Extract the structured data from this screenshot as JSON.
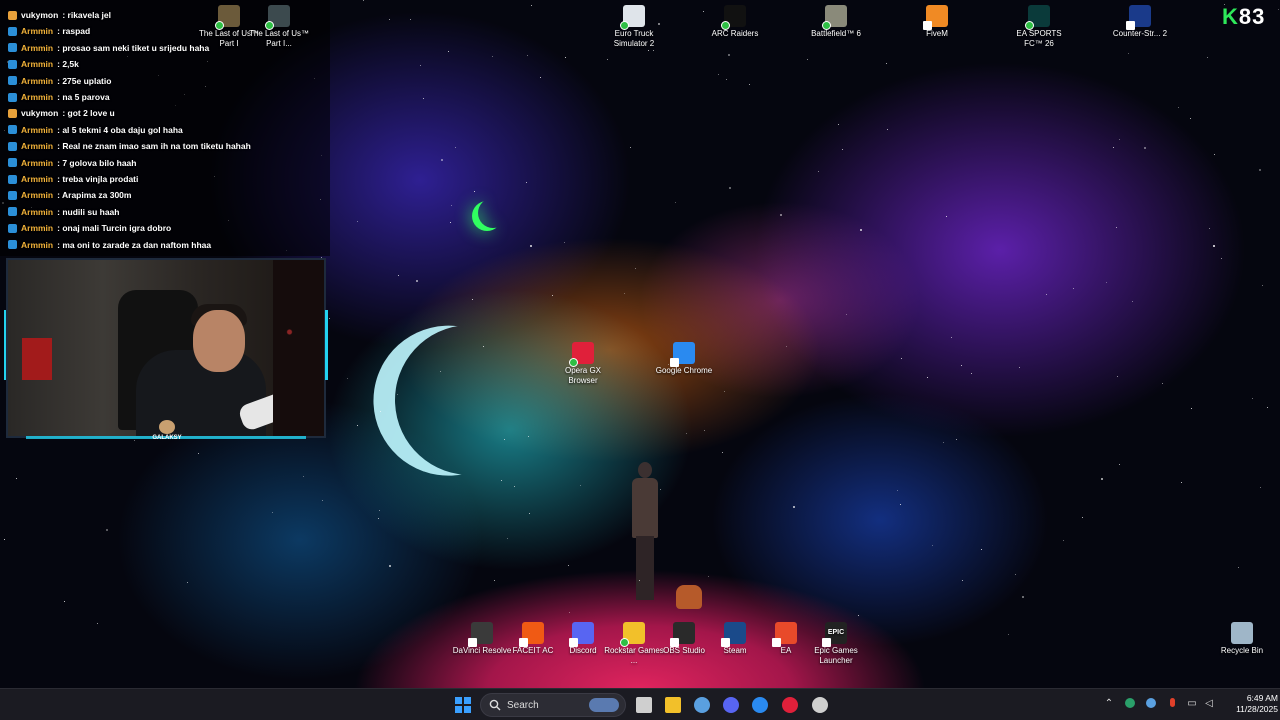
{
  "chat": {
    "messages": [
      {
        "user": "vukymon",
        "text": ": rikavela jel",
        "badge_color": "#e8a13b",
        "user_color": "#ffffff"
      },
      {
        "user": "Armmin",
        "text": ": raspad",
        "badge_color": "#2b8fd8",
        "user_color": "#f2b23a"
      },
      {
        "user": "Armmin",
        "text": ": prosao sam neki tiket u srijedu haha",
        "badge_color": "#2b8fd8",
        "user_color": "#f2b23a"
      },
      {
        "user": "Armmin",
        "text": ": 2,5k",
        "badge_color": "#2b8fd8",
        "user_color": "#f2b23a"
      },
      {
        "user": "Armmin",
        "text": ": 275e uplatio",
        "badge_color": "#2b8fd8",
        "user_color": "#f2b23a"
      },
      {
        "user": "Armmin",
        "text": ": na 5 parova",
        "badge_color": "#2b8fd8",
        "user_color": "#f2b23a"
      },
      {
        "user": "vukymon",
        "text": ": got 2 love u",
        "badge_color": "#e8a13b",
        "user_color": "#ffffff"
      },
      {
        "user": "Armmin",
        "text": ": al 5 tekmi 4 oba daju gol haha",
        "badge_color": "#2b8fd8",
        "user_color": "#f2b23a"
      },
      {
        "user": "Armmin",
        "text": ": Real ne znam imao sam ih na tom tiketu hahah",
        "badge_color": "#2b8fd8",
        "user_color": "#f2b23a"
      },
      {
        "user": "Armmin",
        "text": ": 7 golova bilo haah",
        "badge_color": "#2b8fd8",
        "user_color": "#f2b23a"
      },
      {
        "user": "Armmin",
        "text": ": treba vinjla prodati",
        "badge_color": "#2b8fd8",
        "user_color": "#f2b23a"
      },
      {
        "user": "Armmin",
        "text": ": Arapima za 300m",
        "badge_color": "#2b8fd8",
        "user_color": "#f2b23a"
      },
      {
        "user": "Armmin",
        "text": ": nudili su haah",
        "badge_color": "#2b8fd8",
        "user_color": "#f2b23a"
      },
      {
        "user": "Armmin",
        "text": ": onaj mali Turcin igra dobro",
        "badge_color": "#2b8fd8",
        "user_color": "#f2b23a"
      },
      {
        "user": "Armmin",
        "text": ": ma oni to zarade za dan naftom hhaa",
        "badge_color": "#2b8fd8",
        "user_color": "#f2b23a"
      }
    ]
  },
  "webcam": {
    "logo_text": "GALAKSY"
  },
  "overlay": {
    "k_letter": "K",
    "number": "83",
    "k_color": "#2ee85a"
  },
  "desktop_icons": {
    "top": [
      {
        "label": "The Last of Us™ Part I",
        "color": "#6b5a3a",
        "badge": "check"
      },
      {
        "label": "The Last of Us™ Part I...",
        "color": "#3c4a4e",
        "badge": "check"
      },
      {
        "label": "Euro Truck Simulator 2",
        "color": "#dfe4ea",
        "badge": "check"
      },
      {
        "label": "ARC Raiders",
        "color": "#111111",
        "badge": "check"
      },
      {
        "label": "Battlefield™ 6",
        "color": "#8a8a7a",
        "badge": "check"
      },
      {
        "label": "FiveM",
        "color": "#f08a24",
        "badge": "arrow"
      },
      {
        "label": "EA SPORTS FC™ 26",
        "color": "#0a3a3a",
        "badge": "check"
      },
      {
        "label": "Counter-Str... 2",
        "color": "#1a3a8a",
        "badge": "arrow"
      }
    ],
    "middle": [
      {
        "label": "Opera GX Browser",
        "color": "#e0203a",
        "badge": "check"
      },
      {
        "label": "Google Chrome",
        "color": "#2a8af0",
        "badge": "arrow"
      }
    ],
    "bottom": [
      {
        "label": "DaVinci Resolve",
        "color": "#3a3a3a",
        "badge": "arrow"
      },
      {
        "label": "FACEIT AC",
        "color": "#f05a14",
        "badge": "arrow"
      },
      {
        "label": "Discord",
        "color": "#5865f2",
        "badge": "arrow"
      },
      {
        "label": "Rockstar Games ...",
        "color": "#f2c02a",
        "badge": "check"
      },
      {
        "label": "OBS Studio",
        "color": "#2a2a2a",
        "badge": "arrow"
      },
      {
        "label": "Steam",
        "color": "#1a4a8a",
        "badge": "arrow"
      },
      {
        "label": "EA",
        "color": "#e84a2a",
        "badge": "arrow"
      },
      {
        "label": "Epic Games Launcher",
        "color": "#222222",
        "badge": "arrow",
        "glyph": "EPIC"
      }
    ],
    "recycle": {
      "label": "Recycle Bin",
      "color": "#9fb6c8"
    }
  },
  "taskbar": {
    "search_placeholder": "Search",
    "time": "6:49 AM",
    "date": "11/28/2025",
    "apps": [
      {
        "name": "start",
        "color": "#3aa0ff"
      },
      {
        "name": "task-view",
        "color": "#cfcfcf"
      },
      {
        "name": "file-explorer",
        "color": "#f2c02a"
      },
      {
        "name": "steam",
        "color": "#5aa0e0"
      },
      {
        "name": "discord",
        "color": "#5865f2"
      },
      {
        "name": "chrome",
        "color": "#2a8af0"
      },
      {
        "name": "opera-gx",
        "color": "#e0203a"
      },
      {
        "name": "obs",
        "color": "#cfcfcf"
      }
    ]
  }
}
